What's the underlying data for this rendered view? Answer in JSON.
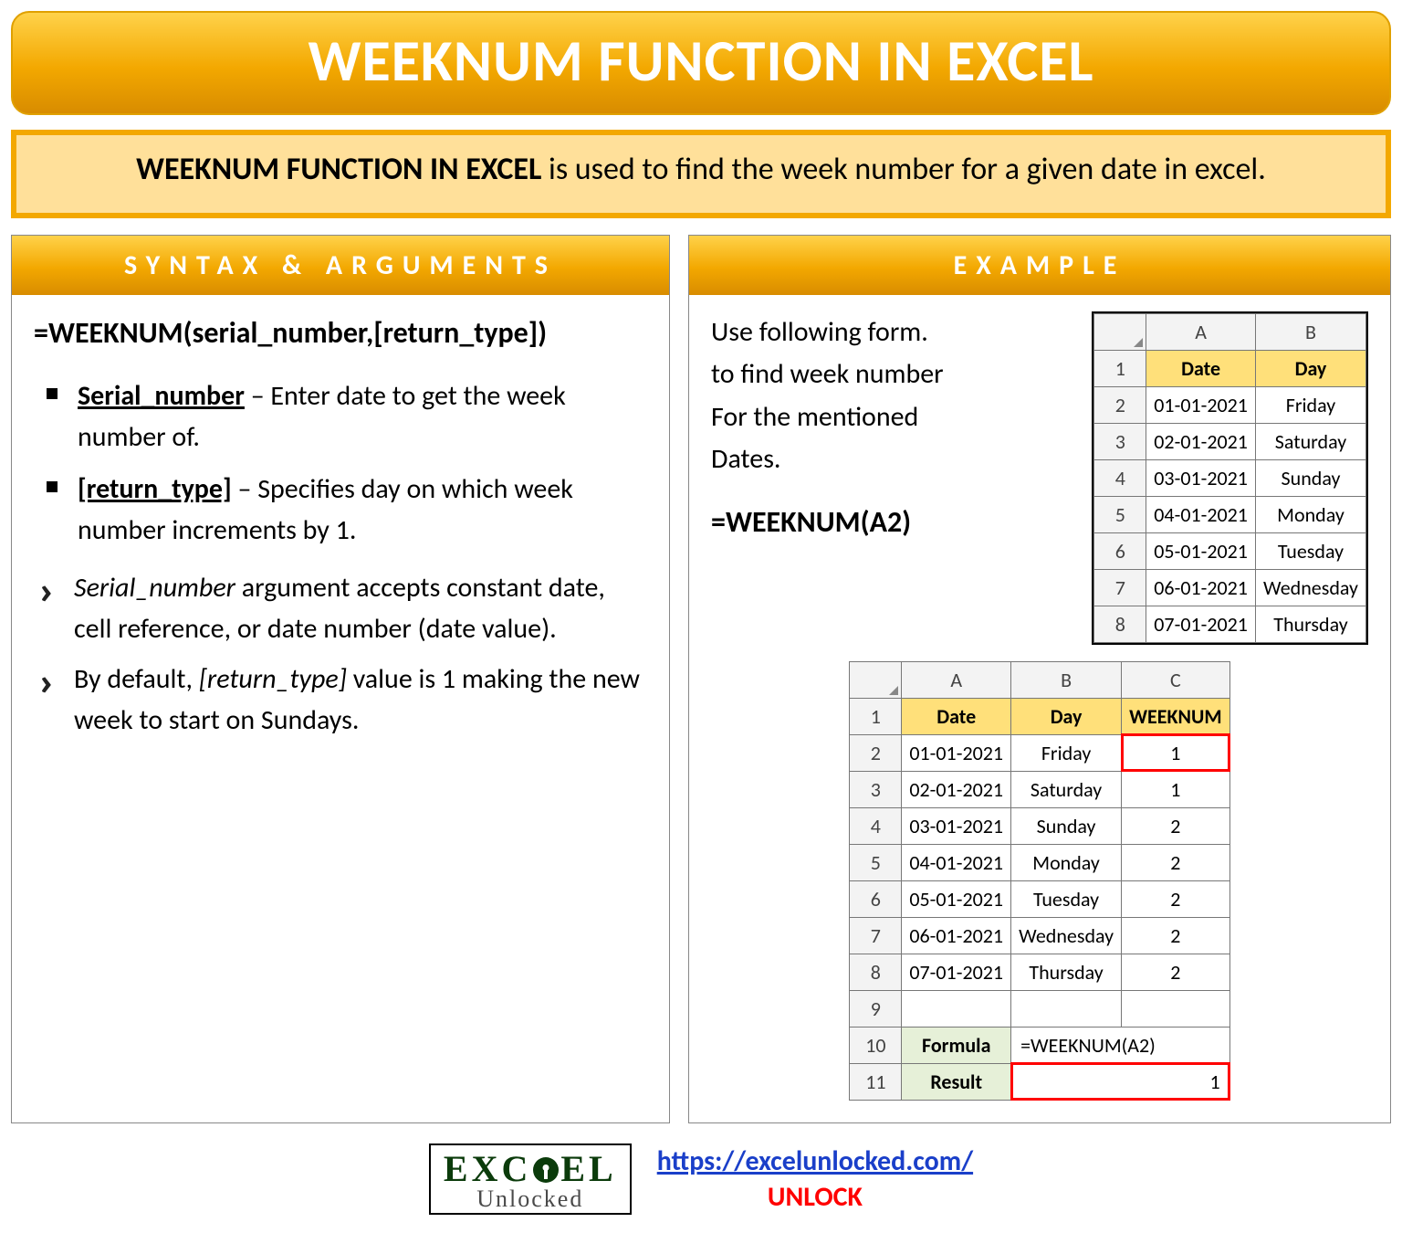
{
  "title": "WEEKNUM FUNCTION IN EXCEL",
  "description": {
    "bold": "WEEKNUM FUNCTION IN EXCEL",
    "rest": " is used to find the week number for a given date in excel."
  },
  "left": {
    "header": "SYNTAX & ARGUMENTS",
    "formula": "=WEEKNUM(serial_number,[return_type])",
    "args": [
      {
        "name": "Serial_number",
        "desc": " – Enter date to get the week number of."
      },
      {
        "name": "[return_type]",
        "desc": " – Specifies day on which week number increments by 1."
      }
    ],
    "notes": [
      {
        "ital": "Serial_number",
        "rest": " argument accepts constant date, cell reference, or date number (date value)."
      },
      {
        "ital": "[return_type]",
        "lead": "By default, ",
        "rest": " value is 1 making the new week to start on Sundays."
      }
    ]
  },
  "right": {
    "header": "EXAMPLE",
    "intro": [
      "Use following form.",
      "to find week number",
      "For the mentioned",
      "Dates."
    ],
    "formula": "=WEEKNUM(A2)",
    "small_table": {
      "cols": [
        "A",
        "B"
      ],
      "headers": [
        "Date",
        "Day"
      ],
      "rows": [
        [
          "01-01-2021",
          "Friday"
        ],
        [
          "02-01-2021",
          "Saturday"
        ],
        [
          "03-01-2021",
          "Sunday"
        ],
        [
          "04-01-2021",
          "Monday"
        ],
        [
          "05-01-2021",
          "Tuesday"
        ],
        [
          "06-01-2021",
          "Wednesday"
        ],
        [
          "07-01-2021",
          "Thursday"
        ]
      ]
    },
    "big_table": {
      "cols": [
        "A",
        "B",
        "C"
      ],
      "headers": [
        "Date",
        "Day",
        "WEEKNUM"
      ],
      "rows": [
        [
          "01-01-2021",
          "Friday",
          "1"
        ],
        [
          "02-01-2021",
          "Saturday",
          "1"
        ],
        [
          "03-01-2021",
          "Sunday",
          "2"
        ],
        [
          "04-01-2021",
          "Monday",
          "2"
        ],
        [
          "05-01-2021",
          "Tuesday",
          "2"
        ],
        [
          "06-01-2021",
          "Wednesday",
          "2"
        ],
        [
          "07-01-2021",
          "Thursday",
          "2"
        ]
      ],
      "formula_label": "Formula",
      "formula_value": "=WEEKNUM(A2)",
      "result_label": "Result",
      "result_value": "1"
    }
  },
  "footer": {
    "logo_line1": "EXC  EL",
    "logo_line2": "Unlocked",
    "url": "https://excelunlocked.com/",
    "unlock": "UNLOCK"
  }
}
